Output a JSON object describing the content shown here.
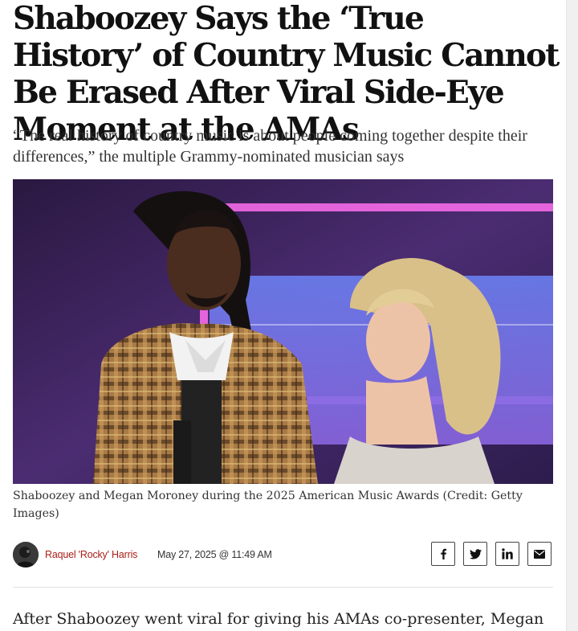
{
  "article": {
    "headline": "Shaboozey Says the ‘True History’ of Country Music Cannot Be Erased After Viral Side-Eye Moment at the AMAs",
    "dek": "“The real history of country music is about people coming together despite their differences,” the multiple Grammy-nominated musician says",
    "image_caption": "Shaboozey and Megan Moroney during the 2025 American Music Awards (Credit: Getty Images)",
    "author": "Raquel 'Rocky' Harris",
    "date": "May 27, 2025 @ 11:49 AM",
    "body_start": "After Shaboozey went viral for giving his AMAs co-presenter, Megan"
  },
  "share": {
    "icons": [
      "facebook-icon",
      "twitter-icon",
      "linkedin-icon",
      "email-icon"
    ]
  },
  "colors": {
    "author_link": "#a8201a",
    "text": "#111111",
    "stage_background": "#3a2455"
  }
}
